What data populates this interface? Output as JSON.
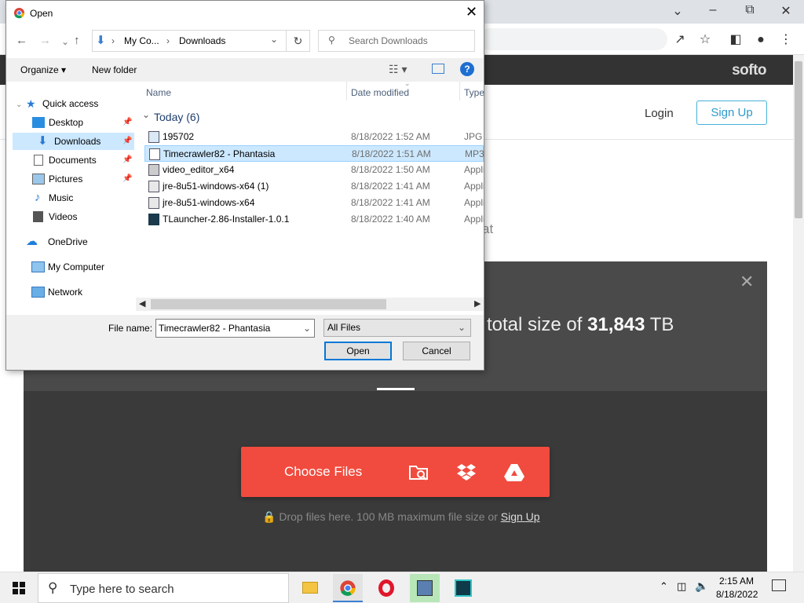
{
  "browser": {
    "site_logo": "softo",
    "login": "Login",
    "signup": "Sign Up",
    "ghost_text": "at",
    "upload": {
      "total_prefix": "total size of",
      "total_value": "31,843",
      "total_unit": "TB",
      "choose_files": "Choose Files",
      "drop_note": "Drop files here. 100 MB maximum file size or",
      "drop_link": "Sign Up"
    }
  },
  "dialog": {
    "title": "Open",
    "breadcrumb": [
      "My Co...",
      "Downloads"
    ],
    "search_placeholder": "Search Downloads",
    "toolbar": {
      "organize": "Organize",
      "new_folder": "New folder"
    },
    "sidebar": [
      {
        "label": "Quick access",
        "icon": "star-icon"
      },
      {
        "label": "Desktop",
        "icon": "desktop-icon",
        "pinned": true
      },
      {
        "label": "Downloads",
        "icon": "download-icon",
        "pinned": true,
        "selected": true
      },
      {
        "label": "Documents",
        "icon": "documents-icon",
        "pinned": true
      },
      {
        "label": "Pictures",
        "icon": "pictures-icon",
        "pinned": true
      },
      {
        "label": "Music",
        "icon": "music-icon"
      },
      {
        "label": "Videos",
        "icon": "videos-icon"
      },
      {
        "label": "OneDrive",
        "icon": "cloud-icon"
      },
      {
        "label": "My Computer",
        "icon": "computer-icon"
      },
      {
        "label": "Network",
        "icon": "network-icon"
      }
    ],
    "columns": {
      "name": "Name",
      "date": "Date modified",
      "type": "Type"
    },
    "group": "Today (6)",
    "files": [
      {
        "name": "195702",
        "date": "8/18/2022 1:52 AM",
        "type": "JPG F"
      },
      {
        "name": "Timecrawler82 - Phantasia",
        "date": "8/18/2022 1:51 AM",
        "type": "MP3"
      },
      {
        "name": "video_editor_x64",
        "date": "8/18/2022 1:50 AM",
        "type": "Appli"
      },
      {
        "name": "jre-8u51-windows-x64 (1)",
        "date": "8/18/2022 1:41 AM",
        "type": "Appli"
      },
      {
        "name": "jre-8u51-windows-x64",
        "date": "8/18/2022 1:41 AM",
        "type": "Appli"
      },
      {
        "name": "TLauncher-2.86-Installer-1.0.1",
        "date": "8/18/2022 1:40 AM",
        "type": "Appli"
      }
    ],
    "filename_label": "File name:",
    "filename_value": "Timecrawler82 - Phantasia",
    "filetype_value": "All Files",
    "open_btn": "Open",
    "cancel_btn": "Cancel"
  },
  "taskbar": {
    "search_placeholder": "Type here to search",
    "time": "2:15 AM",
    "date": "8/18/2022"
  }
}
